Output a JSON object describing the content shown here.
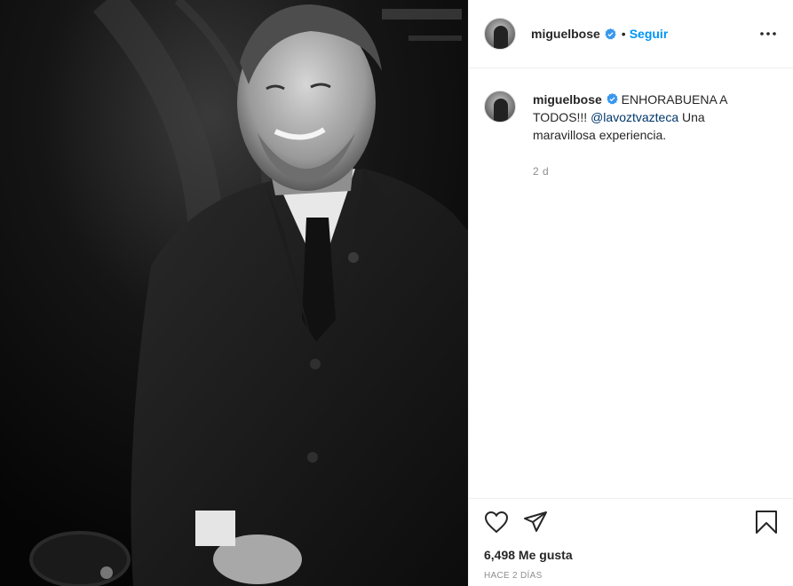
{
  "post": {
    "image_alt": "Black and white portrait of a smiling man in a suit"
  },
  "header": {
    "username": "miguelbose",
    "separator": "•",
    "follow_label": "Seguir",
    "more_icon": "more-horizontal-icon",
    "verified_icon": "verified-badge-icon",
    "verified_color": "#3897f0"
  },
  "caption": {
    "username": "miguelbose",
    "text_before": " ENHORABUENA A TODOS!!! ",
    "mention": "@lavoztvazteca",
    "text_after": " Una maravillosa experiencia.",
    "time": "2 d"
  },
  "actions": {
    "like_icon": "heart-icon",
    "share_icon": "paper-plane-icon",
    "save_icon": "bookmark-icon",
    "likes_text": "6,498 Me gusta",
    "date_text": "HACE 2 DÍAS"
  },
  "colors": {
    "accent": "#0095f6",
    "mention": "#00376b",
    "muted": "#8e8e8e",
    "text": "#262626"
  }
}
